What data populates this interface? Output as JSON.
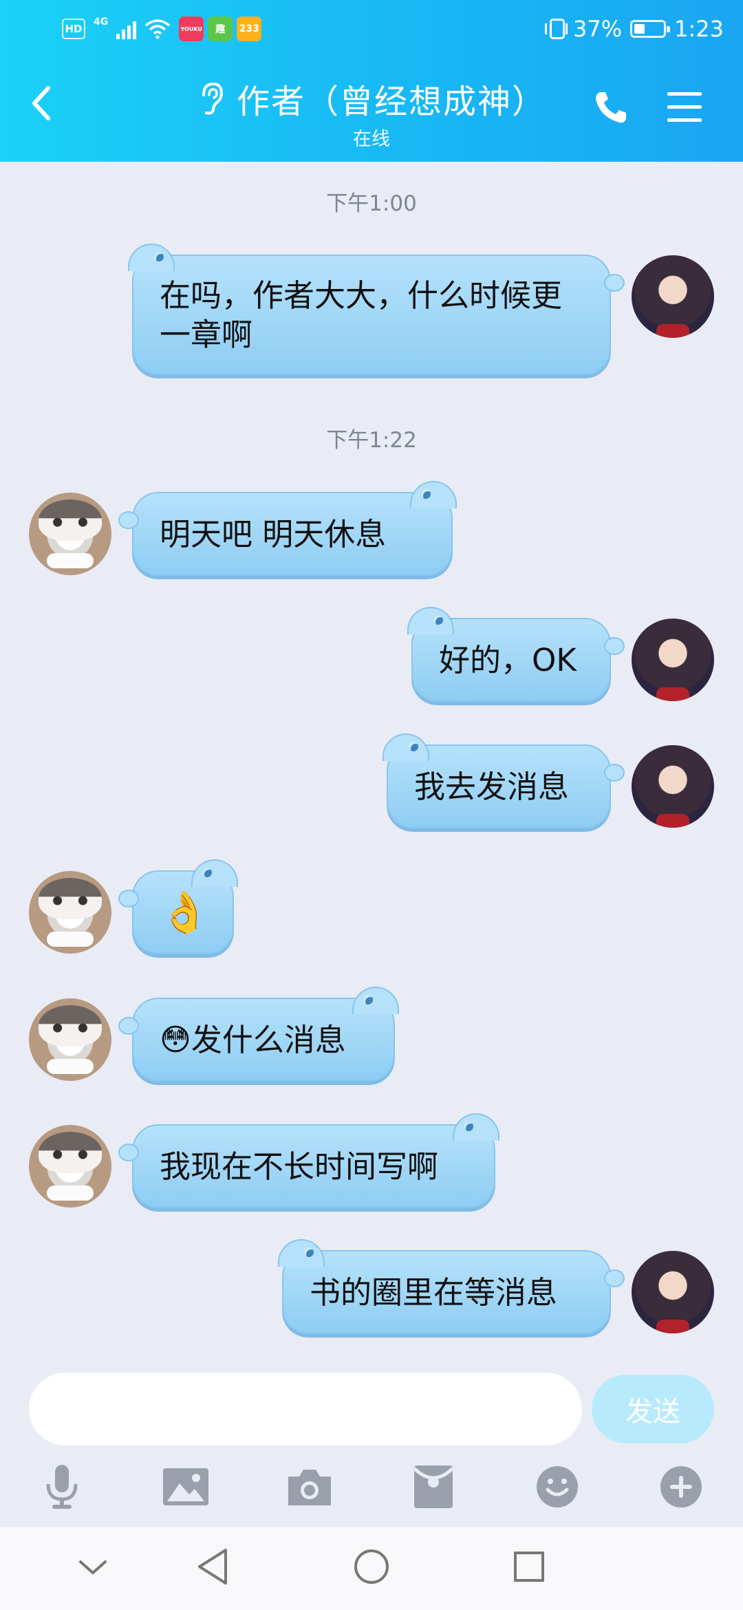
{
  "status_bar": {
    "hd": "HD",
    "network": "4G",
    "battery_percent": "37%",
    "battery_level": 0.37,
    "time": "1:23",
    "app_icons": [
      {
        "name": "youku-app-icon",
        "color": "#f03b5a",
        "label": "YOUKU"
      },
      {
        "name": "reader-app-icon",
        "color": "#5cc64a",
        "label": "趣"
      },
      {
        "name": "233-app-icon",
        "color": "#ffb11b",
        "label": "233"
      }
    ]
  },
  "header": {
    "title": "作者（曾经想成神）",
    "subtitle": "在线",
    "bg_start": "#1bd1f7",
    "bg_end": "#1aa6f2"
  },
  "messages": [
    {
      "type": "time",
      "text": "下午1:00"
    },
    {
      "type": "msg",
      "side": "out",
      "text": "在吗，作者大大，什么时候更一章啊"
    },
    {
      "type": "time",
      "text": "下午1:22"
    },
    {
      "type": "msg",
      "side": "in",
      "text": "明天吧  明天休息"
    },
    {
      "type": "msg",
      "side": "out",
      "text": "好的，OK"
    },
    {
      "type": "msg",
      "side": "out",
      "text": "我去发消息"
    },
    {
      "type": "msg",
      "side": "in",
      "emoji": "👌",
      "text": ""
    },
    {
      "type": "msg",
      "side": "in",
      "emoji": "😳",
      "text": "发什么消息"
    },
    {
      "type": "msg",
      "side": "in",
      "text": "我现在不长时间写啊"
    },
    {
      "type": "msg",
      "side": "out",
      "text": "书的圈里在等消息"
    }
  ],
  "input": {
    "value": "",
    "placeholder": "",
    "send_label": "发送"
  },
  "toolbar": [
    "microphone-icon",
    "image-icon",
    "camera-icon",
    "red-packet-icon",
    "emoji-icon",
    "plus-icon"
  ],
  "nav_bar": [
    "collapse-icon",
    "back-icon",
    "home-icon",
    "recents-icon"
  ],
  "colors": {
    "chat_bg": "#e9ecf5",
    "bubble": "#a6d9f7",
    "send_button": "#b7ebfb"
  }
}
